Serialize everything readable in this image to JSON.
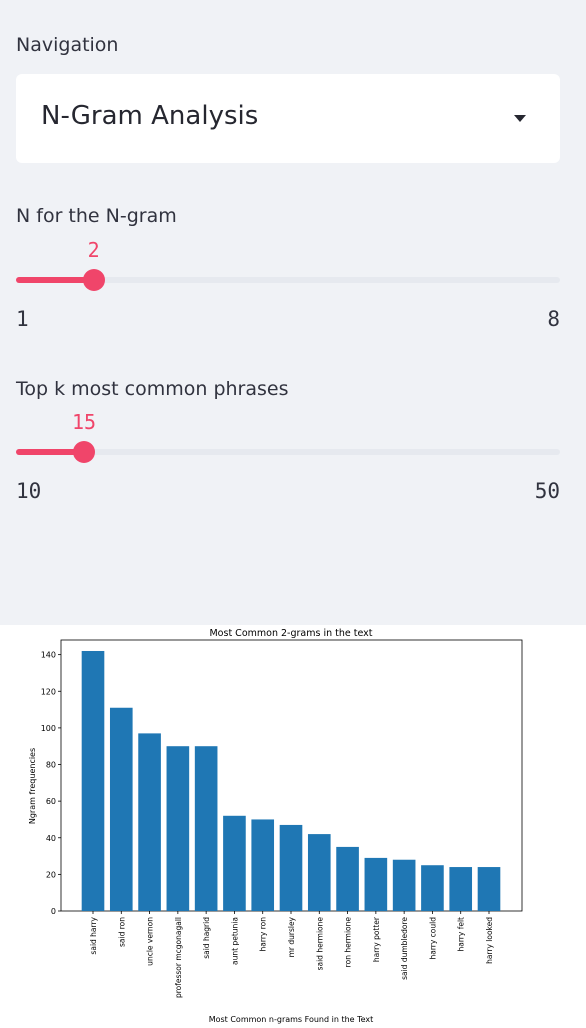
{
  "sidebar": {
    "navigation_label": "Navigation",
    "navigation_selected": "N-Gram Analysis",
    "n_slider": {
      "label": "N for the N-gram",
      "value": 2,
      "min": 1,
      "max": 8
    },
    "k_slider": {
      "label": "Top k most common phrases",
      "value": 15,
      "min": 10,
      "max": 50
    }
  },
  "colors": {
    "accent": "#f0456a",
    "bar": "#1f77b4",
    "sidebar_bg": "#f0f2f6"
  },
  "chart_data": {
    "type": "bar",
    "title": "Most Common 2-grams in the text",
    "xlabel": "Most Common n-grams Found in the Text",
    "ylabel": "Ngram frequencies",
    "ylim": [
      0,
      148
    ],
    "yticks": [
      0,
      20,
      40,
      60,
      80,
      100,
      120,
      140
    ],
    "categories": [
      "said harry",
      "said ron",
      "uncle vernon",
      "professor mcgonagall",
      "said hagrid",
      "aunt petunia",
      "harry ron",
      "mr dursley",
      "said hermione",
      "ron hermione",
      "harry potter",
      "said dumbledore",
      "harry could",
      "harry felt",
      "harry looked"
    ],
    "values": [
      142,
      111,
      97,
      90,
      90,
      52,
      50,
      47,
      42,
      35,
      29,
      28,
      25,
      24,
      24
    ],
    "grid": false
  }
}
